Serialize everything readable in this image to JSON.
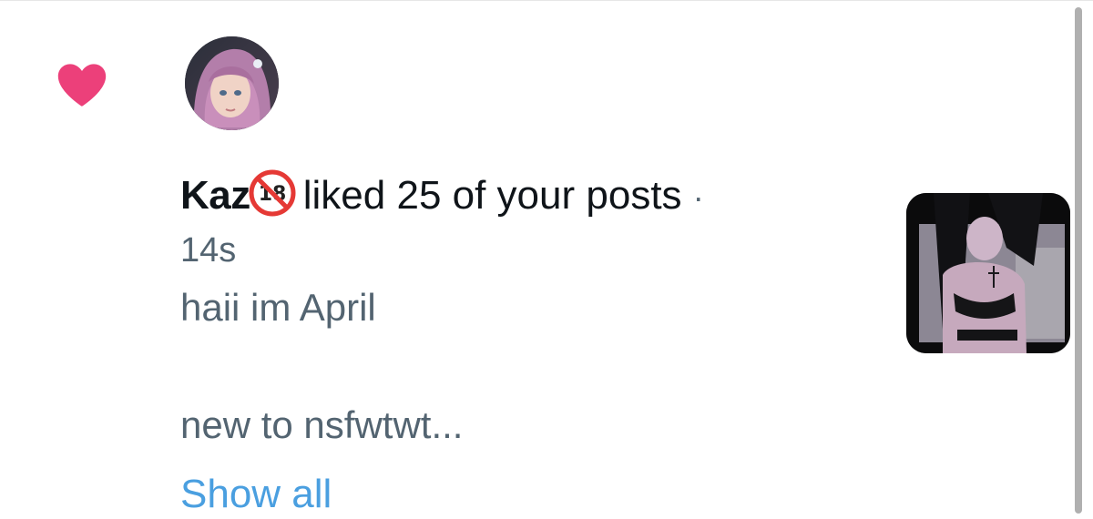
{
  "notification": {
    "icon": "heart-icon",
    "icon_color": "#ec407a",
    "avatar": "avatar-image",
    "username": "Kaz",
    "username_badge": "no-one-under-18-emoji",
    "action_text": "liked 25 of your posts",
    "separator": "·",
    "timestamp": "14s",
    "preview": {
      "line1": "haii im April",
      "line2": "new to nsfwtwt..."
    },
    "show_all_label": "Show all",
    "link_color": "#4a9fe0",
    "thumbnail": "post-thumbnail-image"
  }
}
